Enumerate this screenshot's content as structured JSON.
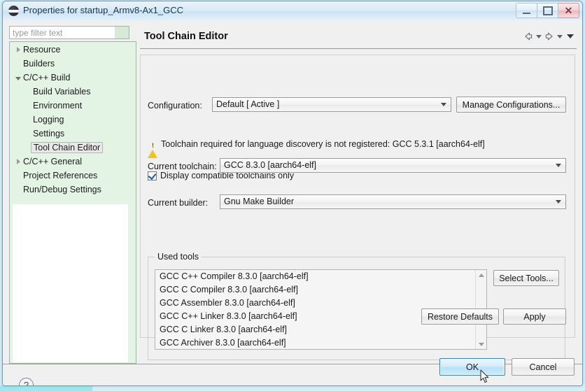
{
  "window": {
    "title": "Properties for startup_Armv8-Ax1_GCC",
    "icon": "eclipse-icon",
    "controls": {
      "minimize": "minimize-icon",
      "maximize": "maximize-icon",
      "close": "close-icon"
    }
  },
  "filter": {
    "placeholder": "type filter text",
    "value": ""
  },
  "tree": {
    "items": [
      {
        "label": "Resource",
        "level": 0,
        "twisty": "closed",
        "selected": false
      },
      {
        "label": "Builders",
        "level": 0,
        "twisty": "none",
        "selected": false
      },
      {
        "label": "C/C++ Build",
        "level": 0,
        "twisty": "expanded",
        "selected": false
      },
      {
        "label": "Build Variables",
        "level": 1,
        "twisty": "none",
        "selected": false
      },
      {
        "label": "Environment",
        "level": 1,
        "twisty": "none",
        "selected": false
      },
      {
        "label": "Logging",
        "level": 1,
        "twisty": "none",
        "selected": false
      },
      {
        "label": "Settings",
        "level": 1,
        "twisty": "none",
        "selected": false
      },
      {
        "label": "Tool Chain Editor",
        "level": 1,
        "twisty": "none",
        "selected": true
      },
      {
        "label": "C/C++ General",
        "level": 0,
        "twisty": "closed",
        "selected": false
      },
      {
        "label": "Project References",
        "level": 0,
        "twisty": "none",
        "selected": false
      },
      {
        "label": "Run/Debug Settings",
        "level": 0,
        "twisty": "none",
        "selected": false
      }
    ]
  },
  "page": {
    "title": "Tool Chain Editor",
    "nav": {
      "back": "back-arrow-icon",
      "back_menu": "chevron-down-icon",
      "forward": "forward-arrow-icon",
      "forward_menu": "chevron-down-icon",
      "view_menu": "chevron-down-icon"
    },
    "configuration": {
      "label": "Configuration:",
      "value": "Default  [ Active ]",
      "manage_button": "Manage Configurations..."
    },
    "warning": {
      "icon": "warning-triangle-icon",
      "text": "Toolchain required for language discovery is not registered: GCC 5.3.1 [aarch64-elf]"
    },
    "display_compatible": {
      "label": "Display compatible toolchains only",
      "checked": true
    },
    "current_toolchain": {
      "label": "Current toolchain:",
      "value": "GCC 8.3.0 [aarch64-elf]"
    },
    "current_builder": {
      "label": "Current builder:",
      "value": "Gnu Make Builder"
    },
    "used_tools": {
      "legend": "Used tools",
      "items": [
        "GCC C++ Compiler 8.3.0 [aarch64-elf]",
        "GCC C Compiler 8.3.0 [aarch64-elf]",
        "GCC Assembler 8.3.0 [aarch64-elf]",
        "GCC C++ Linker 8.3.0 [aarch64-elf]",
        "GCC C Linker 8.3.0 [aarch64-elf]",
        "GCC Archiver 8.3.0 [aarch64-elf]"
      ],
      "select_button": "Select Tools..."
    },
    "restore_defaults": "Restore Defaults",
    "apply": "Apply"
  },
  "footer": {
    "help": "?",
    "ok": "OK",
    "cancel": "Cancel"
  },
  "colors": {
    "accent": "#3c7fb1",
    "tree_background": "#e3f3e4",
    "warning": "#f0c419",
    "dialog_background": "#f0f0f0",
    "desktop": "#d6eef5",
    "taskbar": "#9fe6f0"
  }
}
